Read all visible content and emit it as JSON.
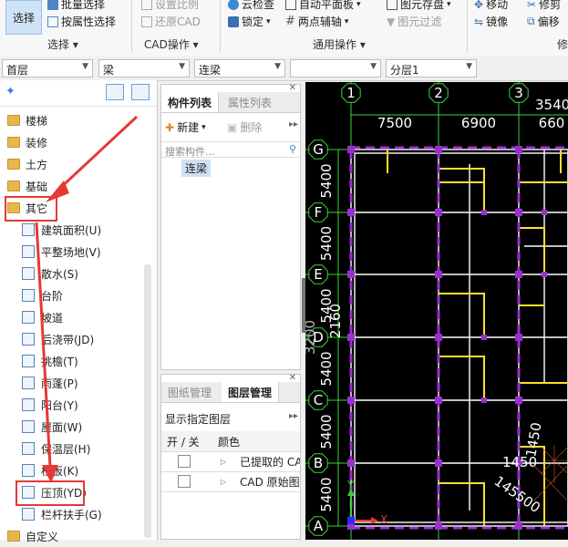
{
  "ribbon": {
    "select_button": "选择",
    "batch_select": "批量选择",
    "attr_select": "按属性选择",
    "set_ratio": "设置比例",
    "restore_cad": "还原CAD",
    "cloud_check": "云检查",
    "auto_floor_plan": "自动平面板",
    "figure_table": "图元存盘",
    "lock": "锁定",
    "two_point_axis": "两点辅轴",
    "figure_filter": "图元过滤",
    "move": "移动",
    "trim": "修剪",
    "mirror": "镜像",
    "offset": "偏移",
    "groups": {
      "select": "选择",
      "cad": "CAD操作",
      "common": "通用操作",
      "modify": "修"
    }
  },
  "selectors": {
    "floor": "首层",
    "component": "梁",
    "type": "连梁",
    "blank": "",
    "layer": "分层1"
  },
  "tree": {
    "folders": [
      "楼梯",
      "装修",
      "土方",
      "基础",
      "其它"
    ],
    "items": [
      "建筑面积(U)",
      "平整场地(V)",
      "散水(S)",
      "台阶",
      "坡道",
      "后浇带(JD)",
      "挑檐(T)",
      "雨蓬(P)",
      "阳台(Y)",
      "屋面(W)",
      "保温层(H)",
      "栏板(K)",
      "压顶(YD)",
      "栏杆扶手(G)"
    ],
    "last_folder": "自定义"
  },
  "component_panel": {
    "tab_active": "构件列表",
    "tab_inactive": "属性列表",
    "new_button": "新建",
    "delete_button": "删除",
    "search_placeholder": "搜索构件...",
    "item": "连梁"
  },
  "layer_panel": {
    "tab_inactive": "图纸管理",
    "tab_active": "图层管理",
    "show_layers": "显示指定图层",
    "col_toggle": "开 / 关",
    "col_color": "颜色",
    "rows": [
      "已提取的 CA",
      "CAD 原始图"
    ]
  },
  "cad": {
    "top_axes": [
      "1",
      "2",
      "3"
    ],
    "left_axes": [
      "G",
      "F",
      "E",
      "D",
      "C",
      "B",
      "A"
    ],
    "top_dims": [
      "7500",
      "6900",
      "660"
    ],
    "top_dim_extra": "3540",
    "left_dims": [
      "5400",
      "5400",
      "5400",
      "5400",
      "5400",
      "5400"
    ],
    "vertical_extra": [
      "3200",
      "2160"
    ],
    "misc_texts": [
      "1450",
      "1450",
      "145500"
    ],
    "ucs_x": "X",
    "ucs_y": "Y"
  },
  "colors": {
    "canvas_bg": "#000000",
    "cad_green": "#3ad33a",
    "cad_white": "#ffffff",
    "cad_yellow": "#ffe030",
    "cad_purple": "#9a2fd0",
    "annotation_red": "#e53935"
  }
}
